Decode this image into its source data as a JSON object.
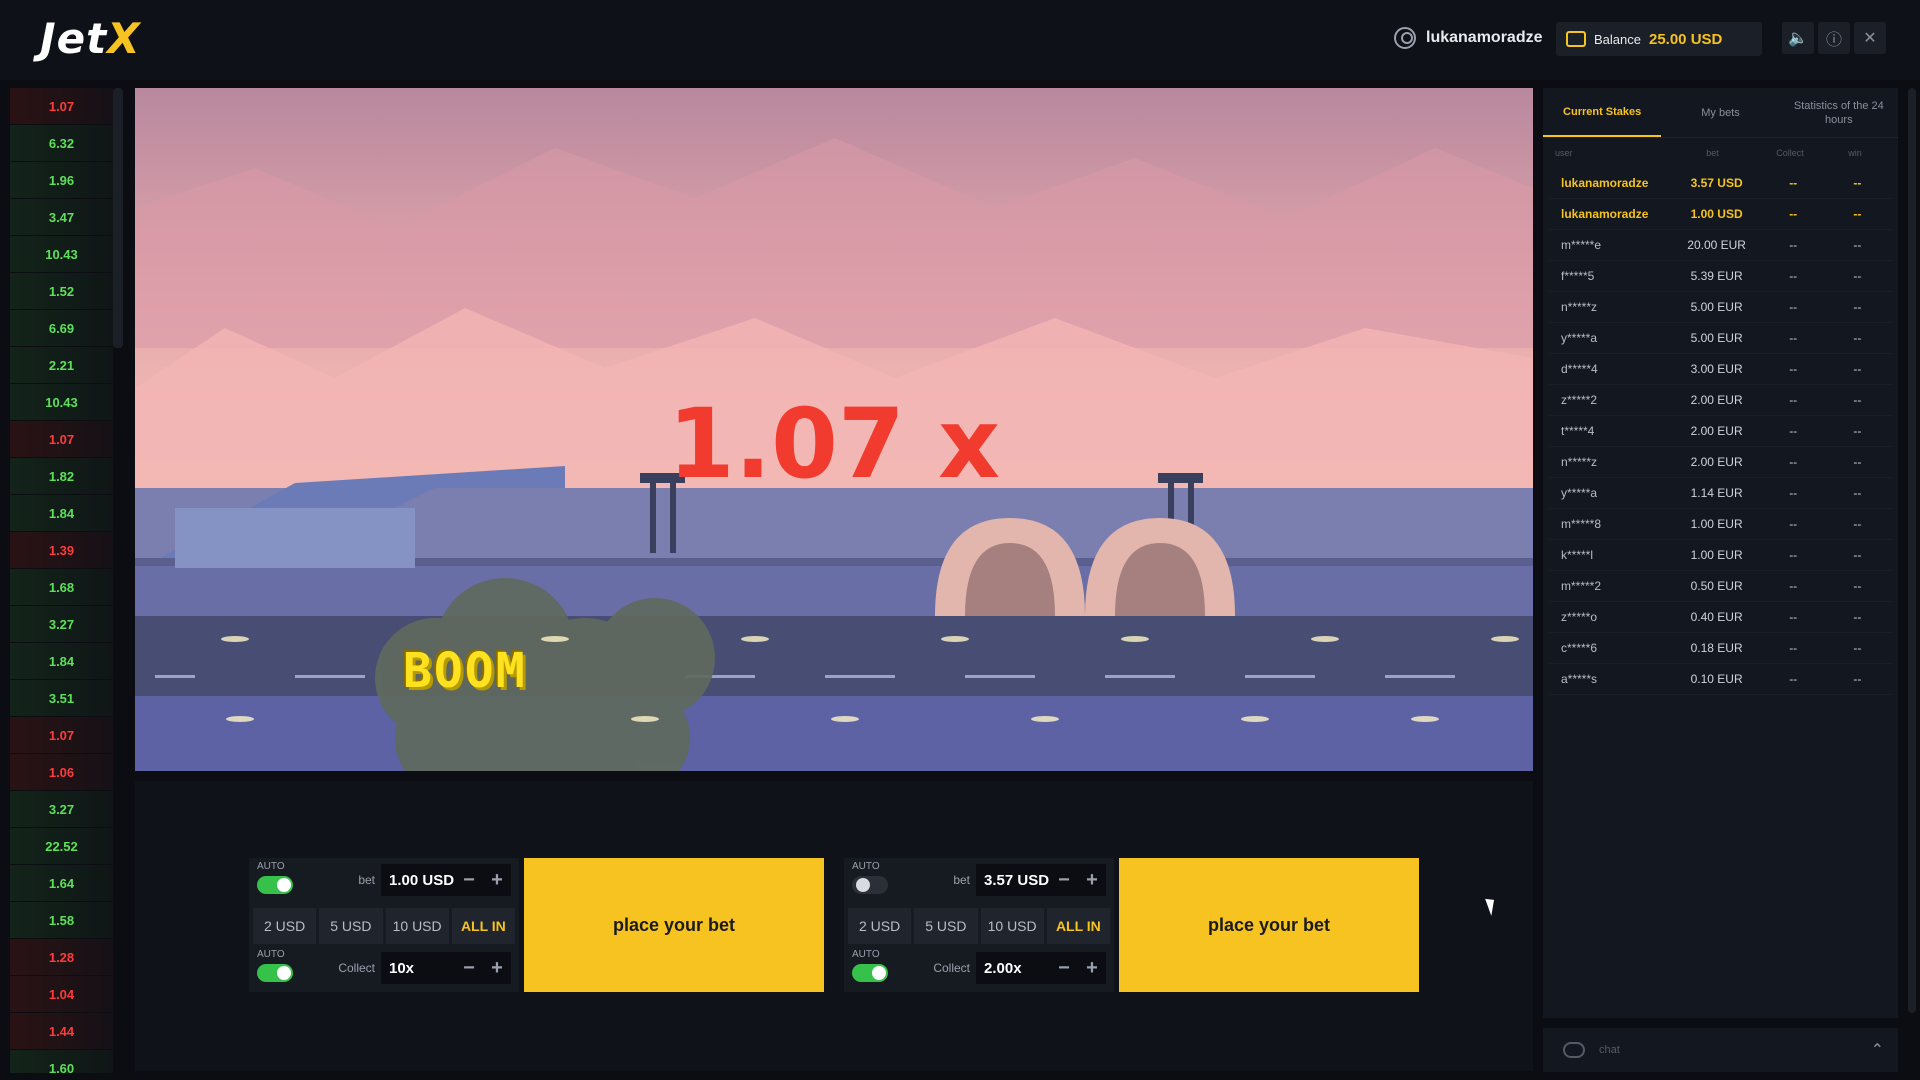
{
  "header": {
    "logo_text": "Jet",
    "logo_accent": "X",
    "username": "lukanamoradze",
    "balance_label": "Balance",
    "balance_value": "25.00 USD"
  },
  "history": [
    {
      "v": "1.07",
      "c": "red"
    },
    {
      "v": "6.32",
      "c": "green"
    },
    {
      "v": "1.96",
      "c": "green"
    },
    {
      "v": "3.47",
      "c": "green"
    },
    {
      "v": "10.43",
      "c": "green"
    },
    {
      "v": "1.52",
      "c": "green"
    },
    {
      "v": "6.69",
      "c": "green"
    },
    {
      "v": "2.21",
      "c": "green"
    },
    {
      "v": "10.43",
      "c": "green"
    },
    {
      "v": "1.07",
      "c": "red"
    },
    {
      "v": "1.82",
      "c": "green"
    },
    {
      "v": "1.84",
      "c": "green"
    },
    {
      "v": "1.39",
      "c": "red"
    },
    {
      "v": "1.68",
      "c": "green"
    },
    {
      "v": "3.27",
      "c": "green"
    },
    {
      "v": "1.84",
      "c": "green"
    },
    {
      "v": "3.51",
      "c": "green"
    },
    {
      "v": "1.07",
      "c": "red"
    },
    {
      "v": "1.06",
      "c": "red"
    },
    {
      "v": "3.27",
      "c": "green"
    },
    {
      "v": "22.52",
      "c": "green"
    },
    {
      "v": "1.64",
      "c": "green"
    },
    {
      "v": "1.58",
      "c": "green"
    },
    {
      "v": "1.28",
      "c": "red"
    },
    {
      "v": "1.04",
      "c": "red"
    },
    {
      "v": "1.44",
      "c": "red"
    },
    {
      "v": "1.60",
      "c": "green"
    }
  ],
  "game": {
    "multiplier": "1.07 x",
    "boom_text": "BOOM"
  },
  "bet_panels": [
    {
      "auto_label": "AUTO",
      "auto_on": true,
      "bet_label": "bet",
      "bet_value": "1.00 USD",
      "chips": [
        "2 USD",
        "5 USD",
        "10 USD",
        "ALL IN"
      ],
      "collect_auto_label": "AUTO",
      "collect_auto_on": true,
      "collect_label": "Collect",
      "collect_value": "10x",
      "place_label": "place your bet"
    },
    {
      "auto_label": "AUTO",
      "auto_on": false,
      "bet_label": "bet",
      "bet_value": "3.57 USD",
      "chips": [
        "2 USD",
        "5 USD",
        "10 USD",
        "ALL IN"
      ],
      "collect_auto_label": "AUTO",
      "collect_auto_on": true,
      "collect_label": "Collect",
      "collect_value": "2.00x",
      "place_label": "place your bet"
    }
  ],
  "sidebar": {
    "tabs": [
      "Current Stakes",
      "My bets",
      "Statistics of the 24 hours"
    ],
    "active_tab": 0,
    "columns": [
      "user",
      "bet",
      "Collect",
      "win"
    ],
    "rows": [
      {
        "user": "lukanamoradze",
        "bet": "3.57 USD",
        "collect": "--",
        "win": "--",
        "me": true
      },
      {
        "user": "lukanamoradze",
        "bet": "1.00 USD",
        "collect": "--",
        "win": "--",
        "me": true
      },
      {
        "user": "m*****e",
        "bet": "20.00 EUR",
        "collect": "--",
        "win": "--",
        "me": false
      },
      {
        "user": "f*****5",
        "bet": "5.39 EUR",
        "collect": "--",
        "win": "--",
        "me": false
      },
      {
        "user": "n*****z",
        "bet": "5.00 EUR",
        "collect": "--",
        "win": "--",
        "me": false
      },
      {
        "user": "y*****a",
        "bet": "5.00 EUR",
        "collect": "--",
        "win": "--",
        "me": false
      },
      {
        "user": "d*****4",
        "bet": "3.00 EUR",
        "collect": "--",
        "win": "--",
        "me": false
      },
      {
        "user": "z*****2",
        "bet": "2.00 EUR",
        "collect": "--",
        "win": "--",
        "me": false
      },
      {
        "user": "t*****4",
        "bet": "2.00 EUR",
        "collect": "--",
        "win": "--",
        "me": false
      },
      {
        "user": "n*****z",
        "bet": "2.00 EUR",
        "collect": "--",
        "win": "--",
        "me": false
      },
      {
        "user": "y*****a",
        "bet": "1.14 EUR",
        "collect": "--",
        "win": "--",
        "me": false
      },
      {
        "user": "m*****8",
        "bet": "1.00 EUR",
        "collect": "--",
        "win": "--",
        "me": false
      },
      {
        "user": "k*****l",
        "bet": "1.00 EUR",
        "collect": "--",
        "win": "--",
        "me": false
      },
      {
        "user": "m*****2",
        "bet": "0.50 EUR",
        "collect": "--",
        "win": "--",
        "me": false
      },
      {
        "user": "z*****o",
        "bet": "0.40 EUR",
        "collect": "--",
        "win": "--",
        "me": false
      },
      {
        "user": "c*****6",
        "bet": "0.18 EUR",
        "collect": "--",
        "win": "--",
        "me": false
      },
      {
        "user": "a*****s",
        "bet": "0.10 EUR",
        "collect": "--",
        "win": "--",
        "me": false
      }
    ],
    "chat_label": "chat"
  },
  "icons": {
    "user": "user-icon",
    "wallet": "wallet-icon",
    "sound": "sound-icon",
    "info": "info-icon",
    "close": "close-icon",
    "chat": "chat-icon",
    "chevron": "chevron-up-icon"
  },
  "colors": {
    "accent": "#f7c321",
    "loss": "#ff3b3b",
    "win": "#5ee05a",
    "multiplier": "#f23b2f"
  }
}
